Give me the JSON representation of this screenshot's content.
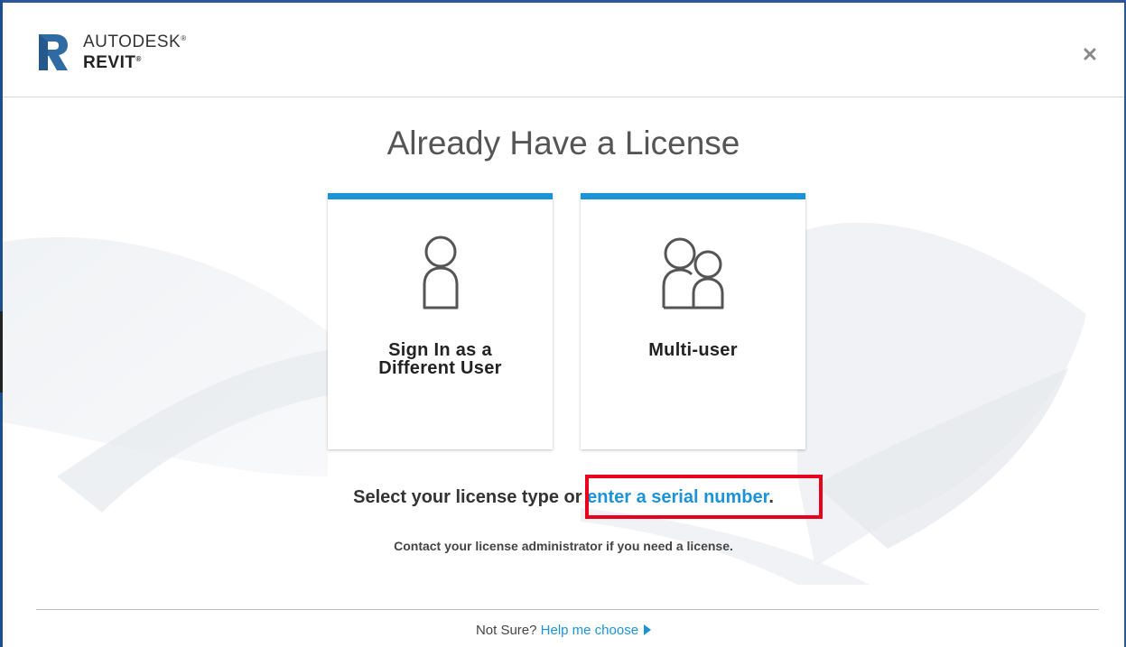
{
  "header": {
    "brand_company": "AUTODESK",
    "brand_product": "REVIT",
    "logo_letter": "R",
    "close_icon": "close-icon"
  },
  "main": {
    "title": "Already Have a License",
    "cards": [
      {
        "label_line1": "Sign In as a",
        "label_line2": "Different User",
        "icon": "single-user-icon"
      },
      {
        "label_line1": "Multi-user",
        "icon": "multi-user-icon"
      }
    ],
    "select_text": "Select your license type or ",
    "serial_link": "enter a serial number",
    "serial_suffix": ".",
    "contact_text": "Contact your license administrator if you need a license."
  },
  "footer": {
    "not_sure": "Not Sure?",
    "help_link": "Help me choose"
  },
  "colors": {
    "accent": "#1c93d7",
    "highlight": "#e8001c"
  }
}
